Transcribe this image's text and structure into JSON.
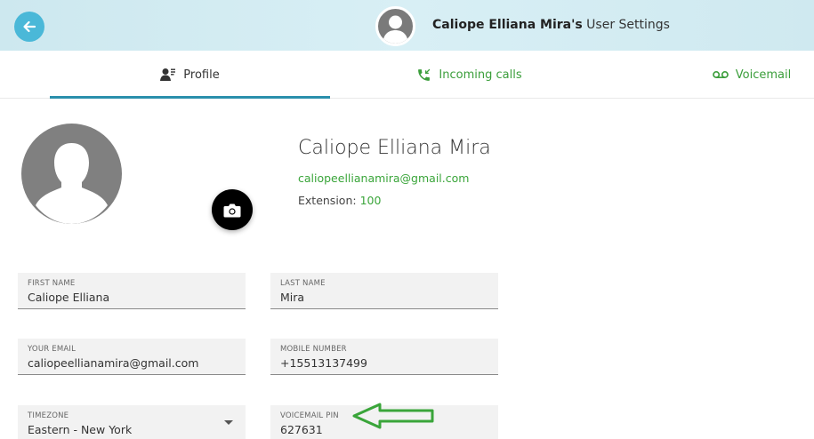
{
  "header": {
    "user_name_bold": "Caliope Elliana Mira's",
    "title_suffix": " User Settings",
    "back_icon": "arrow-left-icon"
  },
  "tabs": [
    {
      "label": "Profile",
      "icon": "user-settings-icon",
      "active": true
    },
    {
      "label": "Incoming calls",
      "icon": "incoming-call-icon",
      "active": false
    },
    {
      "label": "Voicemail",
      "icon": "voicemail-icon",
      "active": false
    }
  ],
  "profile": {
    "name": "Caliope Elliana Mira",
    "email": "caliopeellianamira@gmail.com",
    "extension_label": "Extension:",
    "extension_value": "100",
    "camera_icon": "camera-icon"
  },
  "form": {
    "first_name": {
      "label": "FIRST NAME",
      "value": "Caliope Elliana"
    },
    "last_name": {
      "label": "LAST NAME",
      "value": "Mira"
    },
    "email": {
      "label": "YOUR EMAIL",
      "value": "caliopeellianamira@gmail.com"
    },
    "mobile": {
      "label": "MOBILE NUMBER",
      "value": "+15513137499"
    },
    "timezone": {
      "label": "TIMEZONE",
      "value": "Eastern - New York"
    },
    "voicemail_pin": {
      "label": "VOICEMAIL PIN",
      "value": "627631"
    }
  },
  "colors": {
    "accent_blue": "#4ab8d8",
    "tab_underline": "#2a8fac",
    "green": "#3aa53a",
    "header_bg": "#d8eff5"
  }
}
